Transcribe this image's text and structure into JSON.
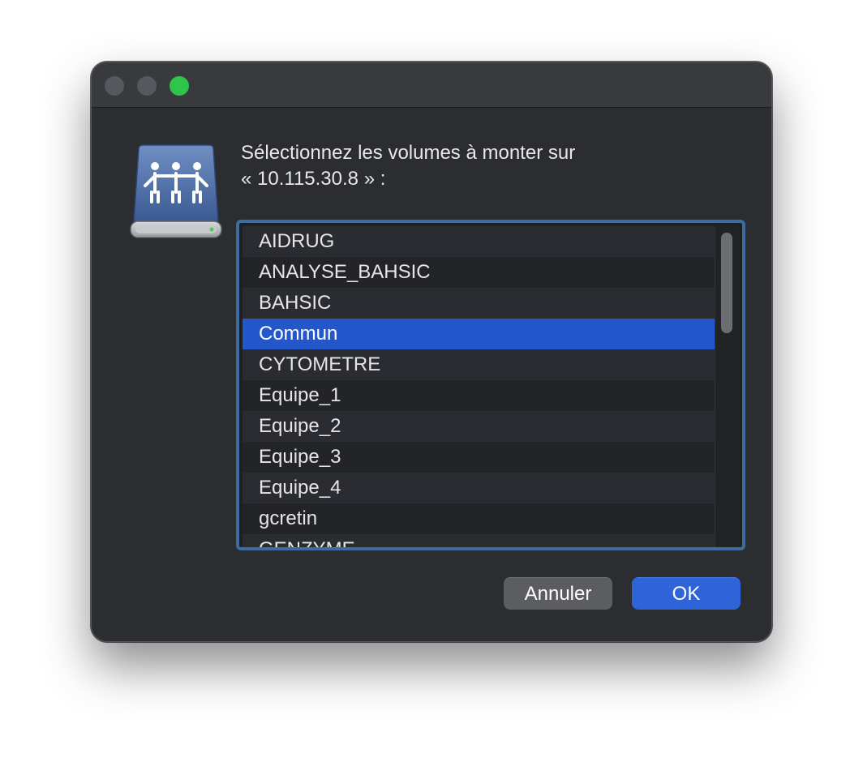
{
  "window": {
    "traffic_lights": [
      "close",
      "minimize",
      "zoom"
    ]
  },
  "icon": "shared-server-volume-icon",
  "message": {
    "line1": "Sélectionnez les volumes à monter sur",
    "line2": "« 10.115.30.8 » :"
  },
  "volumes": {
    "items": [
      {
        "label": "AIDRUG",
        "selected": false
      },
      {
        "label": "ANALYSE_BAHSIC",
        "selected": false
      },
      {
        "label": "BAHSIC",
        "selected": false
      },
      {
        "label": "Commun",
        "selected": true
      },
      {
        "label": "CYTOMETRE",
        "selected": false
      },
      {
        "label": "Equipe_1",
        "selected": false
      },
      {
        "label": "Equipe_2",
        "selected": false
      },
      {
        "label": "Equipe_3",
        "selected": false
      },
      {
        "label": "Equipe_4",
        "selected": false
      },
      {
        "label": "gcretin",
        "selected": false
      },
      {
        "label": "GENZYME",
        "selected": false
      }
    ]
  },
  "buttons": {
    "cancel_label": "Annuler",
    "ok_label": "OK"
  },
  "colors": {
    "selection": "#2357cb",
    "focus_ring": "#3c6d9f",
    "ok_button": "#2f63d8",
    "zoom_button": "#2fc54a"
  }
}
